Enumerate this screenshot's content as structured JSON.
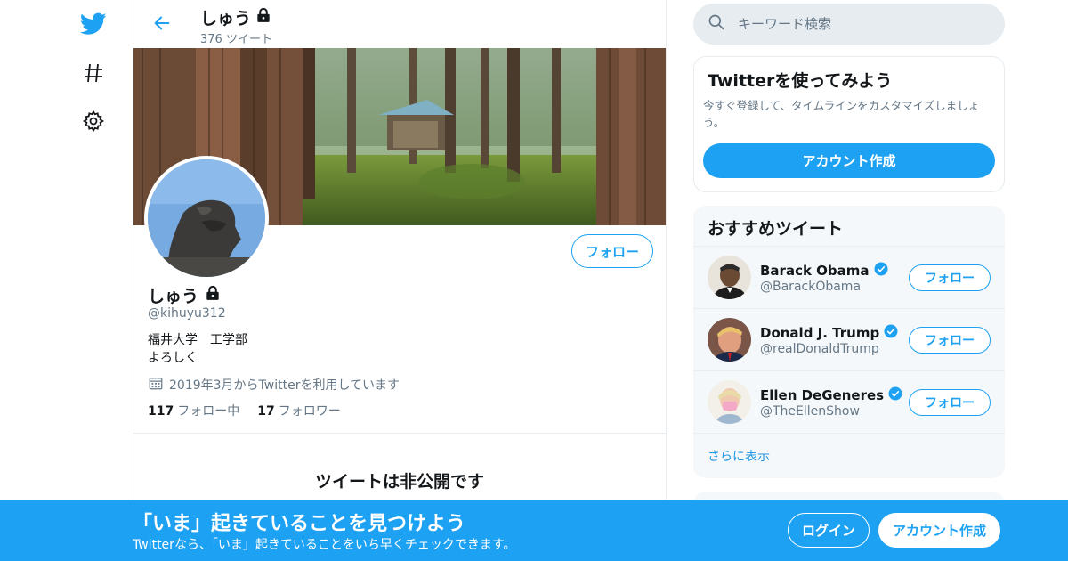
{
  "nav": {
    "items": [
      {
        "icon": "twitter-bird-icon"
      },
      {
        "icon": "hashtag-icon"
      },
      {
        "icon": "gear-icon"
      }
    ]
  },
  "header": {
    "name": "しゅう",
    "tweet_count": "376 ツイート"
  },
  "profile": {
    "name": "しゅう",
    "handle": "@kihuyu312",
    "bio_line1": "福井大学　工学部",
    "bio_line2": "よろしく",
    "joined": "2019年3月からTwitterを利用しています",
    "following_count": "117",
    "following_label": "フォロー中",
    "followers_count": "17",
    "followers_label": "フォロワー",
    "follow_button": "フォロー",
    "private_title": "ツイートは非公開です"
  },
  "search": {
    "placeholder": "キーワード検索"
  },
  "signup_card": {
    "title": "Twitterを使ってみよう",
    "description": "今すぐ登録して、タイムラインをカスタマイズしましょう。",
    "button": "アカウント作成"
  },
  "recommended": {
    "title": "おすすめツイート",
    "users": [
      {
        "name": "Barack Obama",
        "handle": "@BarackObama",
        "follow": "フォロー"
      },
      {
        "name": "Donald J. Trump",
        "handle": "@realDonaldTrump",
        "follow": "フォロー"
      },
      {
        "name": "Ellen DeGeneres",
        "handle": "@TheEllenShow",
        "follow": "フォロー"
      }
    ],
    "show_more": "さらに表示"
  },
  "bottom_bar": {
    "title": "「いま」起きていることを見つけよう",
    "subtitle": "Twitterなら、「いま」起きていることをいち早くチェックできます。",
    "login": "ログイン",
    "signup": "アカウント作成"
  },
  "colors": {
    "accent": "#1da1f2",
    "secondary_text": "#657786",
    "border": "#e6ecf0",
    "card_bg": "#f5f8fa"
  }
}
